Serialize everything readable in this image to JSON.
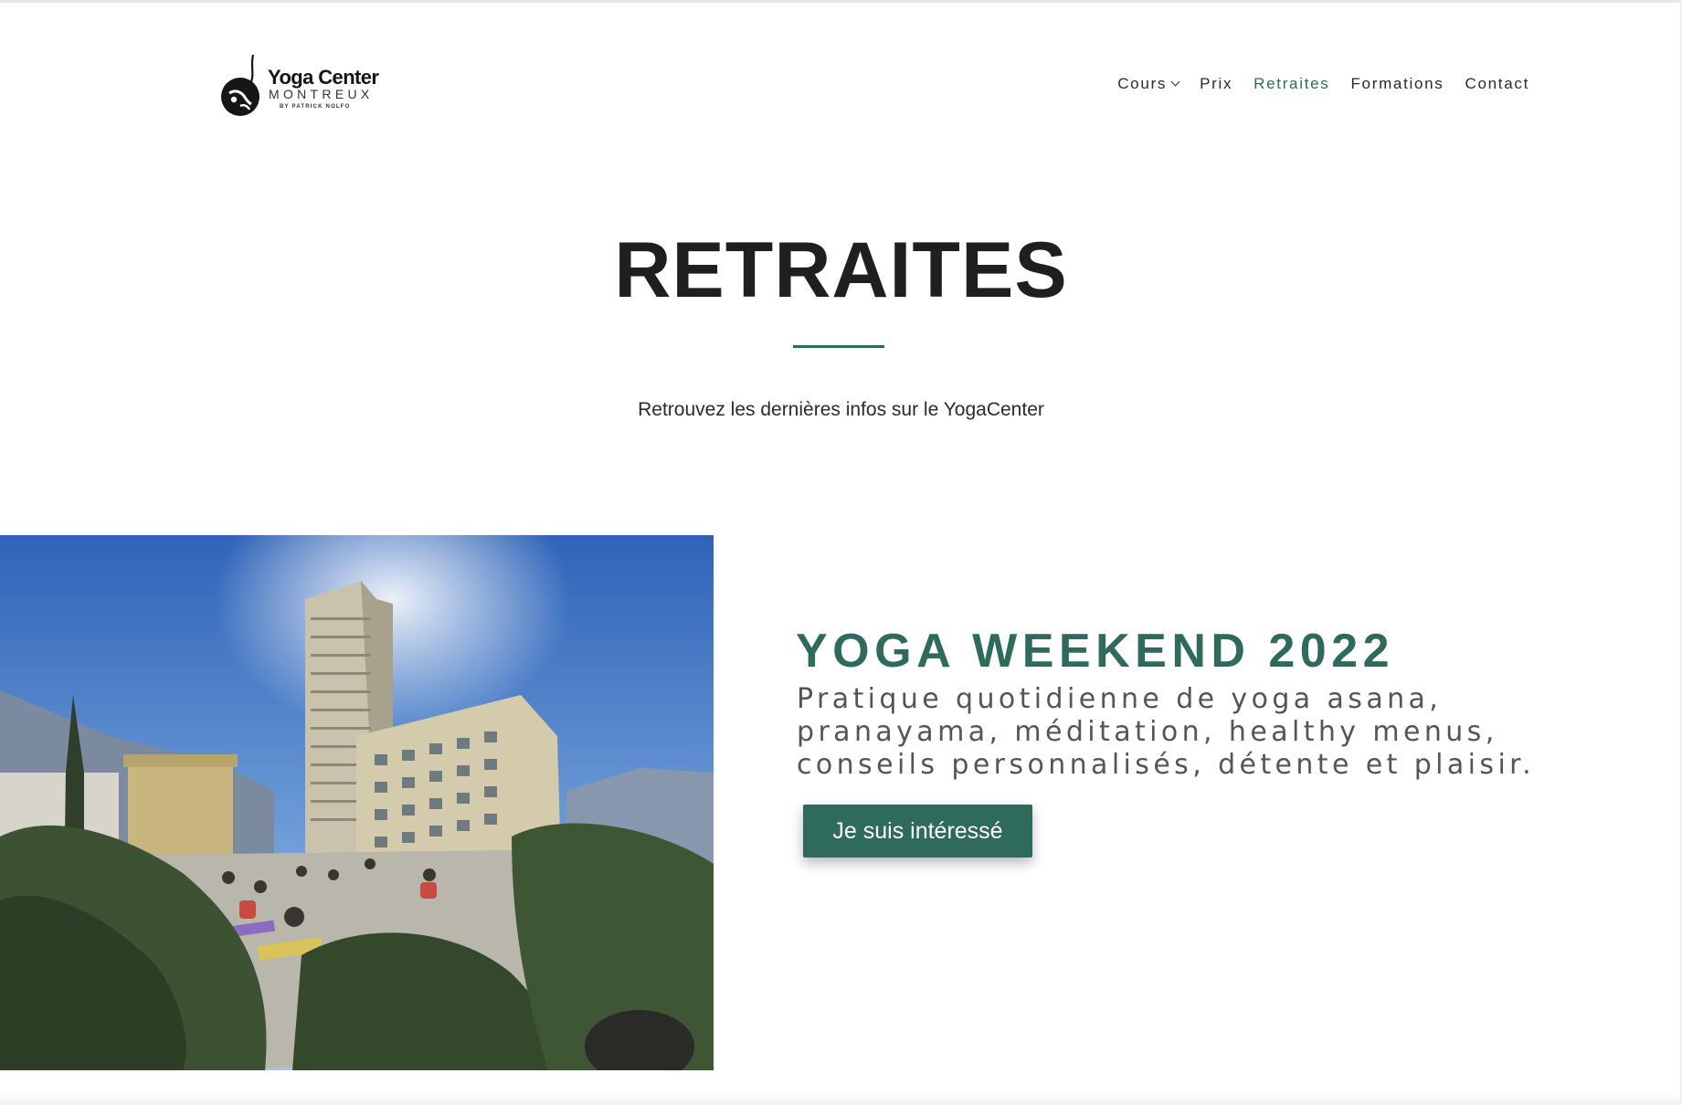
{
  "header": {
    "logo": {
      "title": "Yoga Center",
      "subtitle": "MONTREUX",
      "byline": "BY PATRICK NOLFO"
    },
    "nav": [
      {
        "label": "Cours",
        "has_dropdown": true,
        "active": false
      },
      {
        "label": "Prix",
        "has_dropdown": false,
        "active": false
      },
      {
        "label": "Retraites",
        "has_dropdown": false,
        "active": true
      },
      {
        "label": "Formations",
        "has_dropdown": false,
        "active": false
      },
      {
        "label": "Contact",
        "has_dropdown": false,
        "active": false
      }
    ]
  },
  "hero": {
    "title": "RETRAITES",
    "subtitle": "Retrouvez les dernières infos sur le YogaCenter"
  },
  "feature": {
    "title": "YOGA WEEKEND 2022",
    "description": "Pratique quotidienne de yoga asana, pranayama, méditation, healthy menus, conseils personnalisés, détente et plaisir.",
    "button_label": "Je suis intéressé"
  },
  "colors": {
    "accent": "#2e6b5c",
    "heading": "#1f1f1f",
    "body_text": "#555555"
  }
}
